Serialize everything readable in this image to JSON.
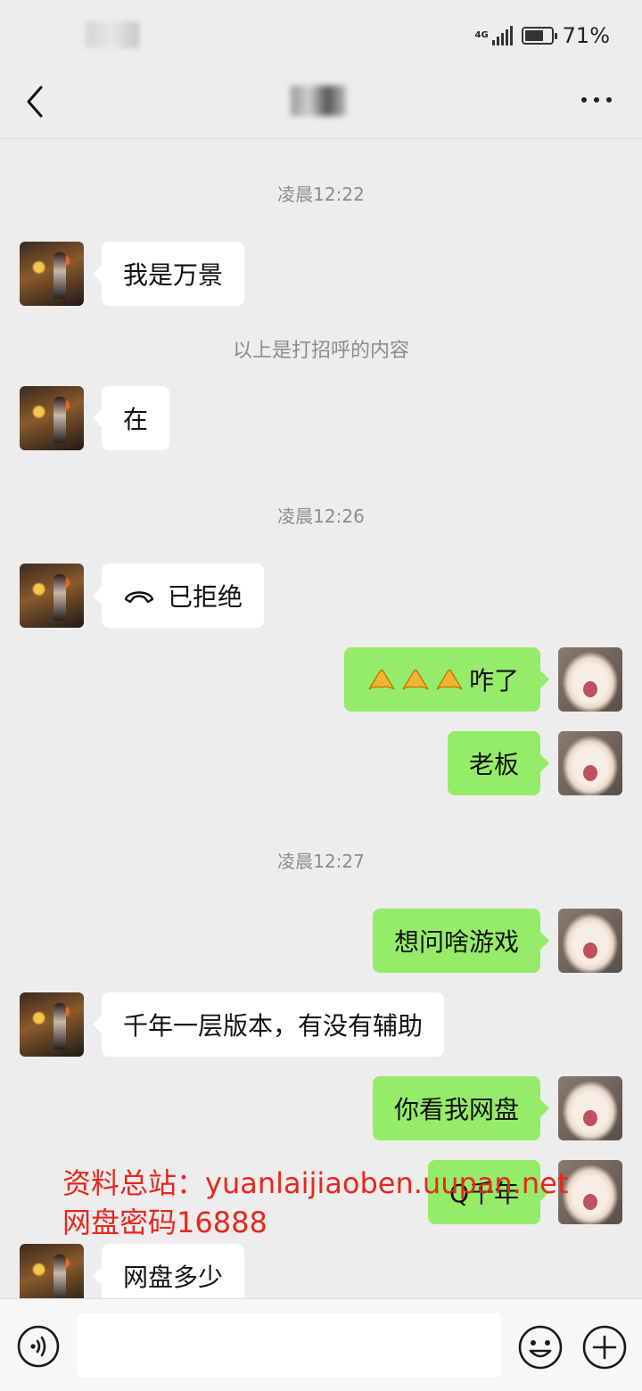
{
  "status_bar": {
    "network": "4G",
    "battery_level": 0.71,
    "battery_text": "71%"
  },
  "messages": [
    {
      "kind": "time",
      "text": "凌晨12:22"
    },
    {
      "kind": "msg",
      "side": "left",
      "text": "我是万景"
    },
    {
      "kind": "sys",
      "text": "以上是打招呼的内容"
    },
    {
      "kind": "msg",
      "side": "left",
      "text": "在"
    },
    {
      "kind": "time",
      "text": "凌晨12:26"
    },
    {
      "kind": "msg",
      "side": "left",
      "text": "已拒绝",
      "icon": "declined-call-icon"
    },
    {
      "kind": "msg",
      "side": "right",
      "text": "咋了",
      "emoji": "clapping-hands-icon",
      "emoji_count": 3
    },
    {
      "kind": "msg",
      "side": "right",
      "text": "老板"
    },
    {
      "kind": "time",
      "text": "凌晨12:27"
    },
    {
      "kind": "msg",
      "side": "right",
      "text": "想问啥游戏"
    },
    {
      "kind": "msg",
      "side": "left",
      "text": "千年一层版本，有没有辅助"
    },
    {
      "kind": "msg",
      "side": "right",
      "text": "你看我网盘"
    },
    {
      "kind": "msg",
      "side": "right",
      "text": "Q千年"
    },
    {
      "kind": "msg",
      "side": "left",
      "text": "网盘多少"
    }
  ],
  "watermark": {
    "line1": "资料总站：yuanlaijiaoben.uupan.net",
    "line2": "网盘密码16888"
  },
  "input_bar": {
    "value": "",
    "placeholder": ""
  },
  "icons": {
    "back": "back-arrow-icon",
    "more": "more-icon",
    "voice": "voice-icon",
    "emoji": "emoji-icon",
    "plus": "plus-icon"
  }
}
